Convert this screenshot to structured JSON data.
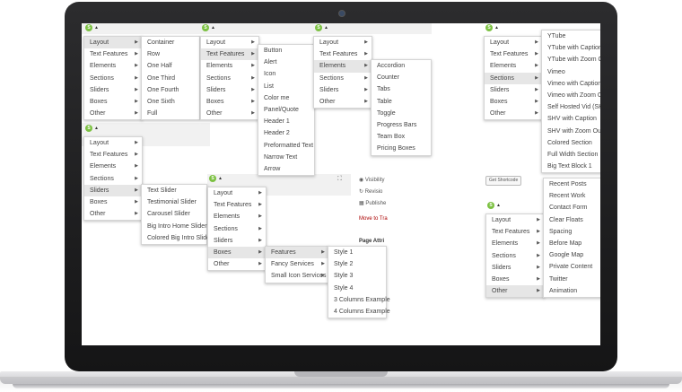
{
  "menus": {
    "m1": {
      "trigger": "S",
      "items": [
        {
          "label": "Layout",
          "arrow": true,
          "active": true
        },
        {
          "label": "Text Features",
          "arrow": true
        },
        {
          "label": "Elements",
          "arrow": true
        },
        {
          "label": "Sections",
          "arrow": true
        },
        {
          "label": "Sliders",
          "arrow": true
        },
        {
          "label": "Boxes",
          "arrow": true
        },
        {
          "label": "Other",
          "arrow": true
        }
      ]
    },
    "m1_sub": {
      "items": [
        {
          "label": "Container"
        },
        {
          "label": "Row"
        },
        {
          "label": "One Half"
        },
        {
          "label": "One Third"
        },
        {
          "label": "One Fourth"
        },
        {
          "label": "One Sixth"
        },
        {
          "label": "Full"
        }
      ]
    },
    "m2": {
      "trigger": "S",
      "items": [
        {
          "label": "Layout",
          "arrow": true
        },
        {
          "label": "Text Features",
          "arrow": true,
          "active": true
        },
        {
          "label": "Elements",
          "arrow": true
        },
        {
          "label": "Sections",
          "arrow": true
        },
        {
          "label": "Sliders",
          "arrow": true
        },
        {
          "label": "Boxes",
          "arrow": true
        },
        {
          "label": "Other",
          "arrow": true
        }
      ]
    },
    "m2_sub": {
      "items": [
        {
          "label": "Button"
        },
        {
          "label": "Alert"
        },
        {
          "label": "Icon"
        },
        {
          "label": "List"
        },
        {
          "label": "Color me"
        },
        {
          "label": "Panel/Quote"
        },
        {
          "label": "Header 1"
        },
        {
          "label": "Header 2"
        },
        {
          "label": "Preformatted Text"
        },
        {
          "label": "Narrow Text"
        },
        {
          "label": "Arrow"
        }
      ]
    },
    "m3": {
      "trigger": "S",
      "items": [
        {
          "label": "Layout",
          "arrow": true
        },
        {
          "label": "Text Features",
          "arrow": true
        },
        {
          "label": "Elements",
          "arrow": true,
          "active": true
        },
        {
          "label": "Sections",
          "arrow": true
        },
        {
          "label": "Sliders",
          "arrow": true
        },
        {
          "label": "Other",
          "arrow": true
        }
      ]
    },
    "m3_sub": {
      "items": [
        {
          "label": "Accordion"
        },
        {
          "label": "Counter"
        },
        {
          "label": "Tabs"
        },
        {
          "label": "Table"
        },
        {
          "label": "Toggle"
        },
        {
          "label": "Progress Bars"
        },
        {
          "label": "Team Box"
        },
        {
          "label": "Pricing Boxes"
        }
      ]
    },
    "m4": {
      "trigger": "S",
      "items": [
        {
          "label": "Layout",
          "arrow": true
        },
        {
          "label": "Text Features",
          "arrow": true
        },
        {
          "label": "Elements",
          "arrow": true
        },
        {
          "label": "Sections",
          "arrow": true,
          "active": true
        },
        {
          "label": "Sliders",
          "arrow": true
        },
        {
          "label": "Boxes",
          "arrow": true
        },
        {
          "label": "Other",
          "arrow": true
        }
      ]
    },
    "m4_sub": {
      "items": [
        {
          "label": "YTube"
        },
        {
          "label": "YTube with Caption"
        },
        {
          "label": "YTube with Zoom Out"
        },
        {
          "label": "Vimeo"
        },
        {
          "label": "Vimeo with Caption"
        },
        {
          "label": "Vimeo with Zoom Out"
        },
        {
          "label": "Self Hosted Vid (SHV)"
        },
        {
          "label": "SHV with Caption"
        },
        {
          "label": "SHV with Zoom Out"
        },
        {
          "label": "Colored Section"
        },
        {
          "label": "Full Width Section"
        },
        {
          "label": "Big Text Block 1"
        }
      ]
    },
    "m5": {
      "trigger": "S",
      "items": [
        {
          "label": "Layout",
          "arrow": true
        },
        {
          "label": "Text Features",
          "arrow": true
        },
        {
          "label": "Elements",
          "arrow": true
        },
        {
          "label": "Sections",
          "arrow": true
        },
        {
          "label": "Sliders",
          "arrow": true,
          "active": true
        },
        {
          "label": "Boxes",
          "arrow": true
        },
        {
          "label": "Other",
          "arrow": true
        }
      ]
    },
    "m5_sub": {
      "items": [
        {
          "label": "Text Slider"
        },
        {
          "label": "Testimonial Slider"
        },
        {
          "label": "Carousel Slider"
        },
        {
          "label": "Big Intro Home Slider"
        },
        {
          "label": "Colored Big Intro Slider"
        }
      ]
    },
    "m6": {
      "trigger": "S",
      "items": [
        {
          "label": "Layout",
          "arrow": true
        },
        {
          "label": "Text Features",
          "arrow": true
        },
        {
          "label": "Elements",
          "arrow": true
        },
        {
          "label": "Sections",
          "arrow": true
        },
        {
          "label": "Sliders",
          "arrow": true
        },
        {
          "label": "Boxes",
          "arrow": true,
          "active": true
        },
        {
          "label": "Other",
          "arrow": true
        }
      ]
    },
    "m6_sub": {
      "items": [
        {
          "label": "Features",
          "arrow": true,
          "active": true
        },
        {
          "label": "Fancy Services",
          "arrow": true
        },
        {
          "label": "Small Icon Services",
          "arrow": true
        }
      ]
    },
    "m6_sub2": {
      "items": [
        {
          "label": "Style 1"
        },
        {
          "label": "Style 2"
        },
        {
          "label": "Style 3"
        },
        {
          "label": "Style 4"
        },
        {
          "label": "3 Columns Example"
        },
        {
          "label": "4 Columns Example"
        }
      ]
    },
    "m7": {
      "trigger": "S",
      "items": [
        {
          "label": "Layout",
          "arrow": true
        },
        {
          "label": "Text Features",
          "arrow": true
        },
        {
          "label": "Elements",
          "arrow": true
        },
        {
          "label": "Sections",
          "arrow": true
        },
        {
          "label": "Sliders",
          "arrow": true
        },
        {
          "label": "Boxes",
          "arrow": true
        },
        {
          "label": "Other",
          "arrow": true,
          "active": true
        }
      ]
    },
    "m7_sub": {
      "items": [
        {
          "label": "Recent Posts"
        },
        {
          "label": "Recent Work"
        },
        {
          "label": "Contact Form"
        },
        {
          "label": "Clear Floats"
        },
        {
          "label": "Spacing"
        },
        {
          "label": "Before Map"
        },
        {
          "label": "Google Map"
        },
        {
          "label": "Private Content"
        },
        {
          "label": "Twitter"
        },
        {
          "label": "Animation"
        }
      ]
    }
  },
  "sidebar": {
    "visibility": "Visibility",
    "revisions": "Revisio",
    "published": "Publishe",
    "move_to_trash": "Move to Tra",
    "page_attributes": "Page Attri"
  },
  "get_shortcode_button": "Get Shortcode",
  "colors": {
    "accent": "#7cc142",
    "trash": "#a00"
  }
}
